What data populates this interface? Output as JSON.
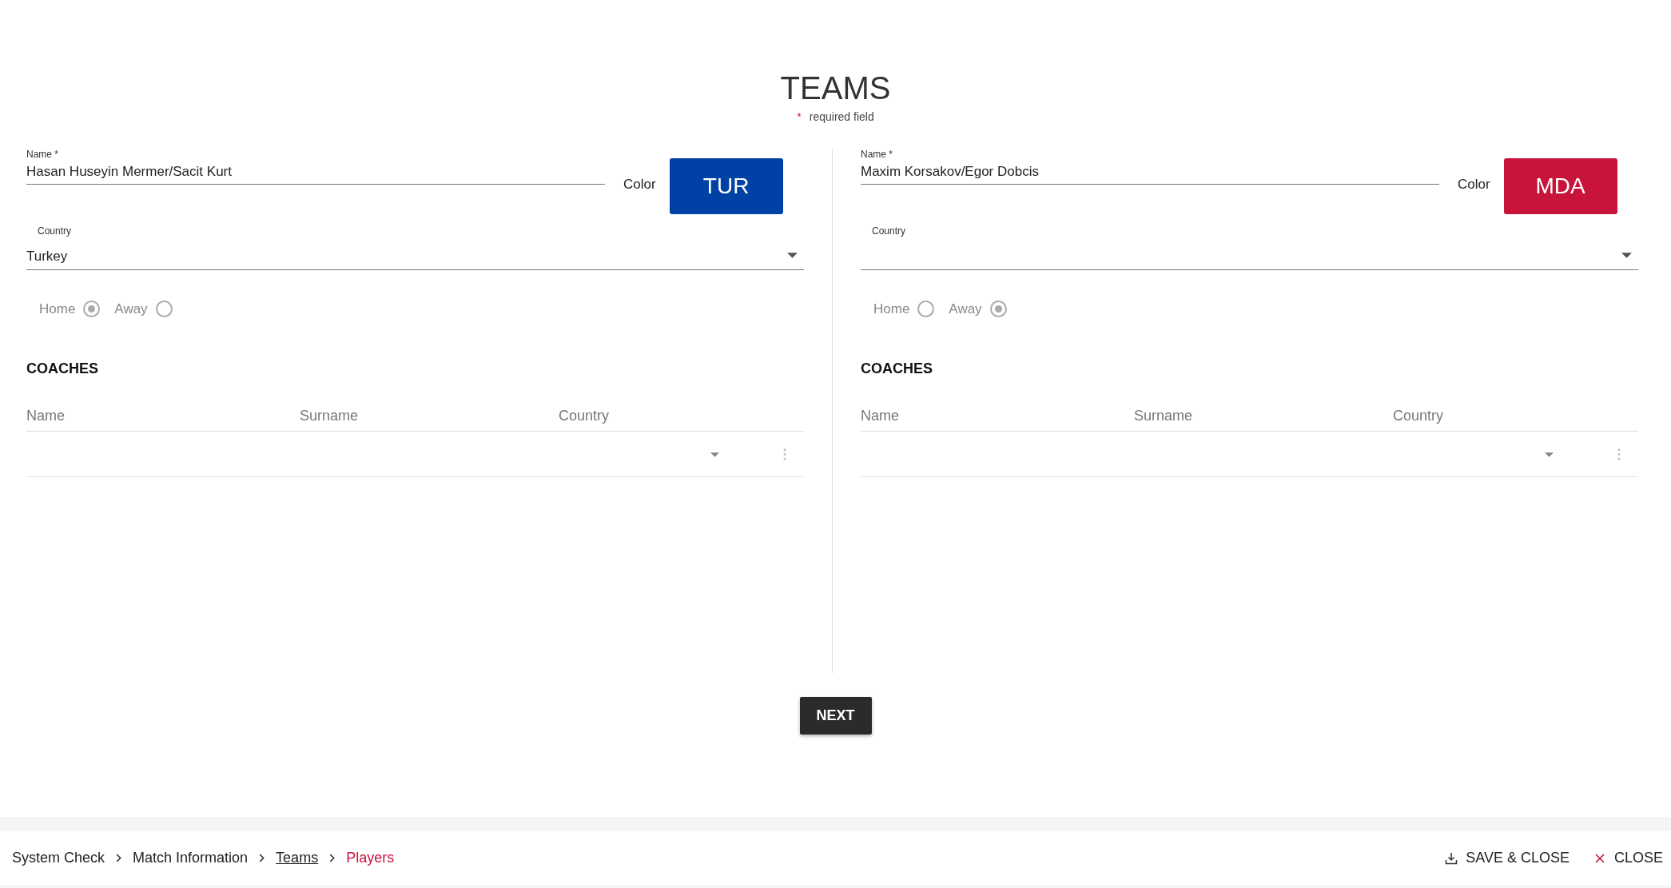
{
  "header": {
    "title": "TEAMS",
    "required_mark": "*",
    "required_note": "required field"
  },
  "teams": [
    {
      "name_label": "Name *",
      "name": "Hasan Huseyin Mermer/Sacit Kurt",
      "color_label": "Color",
      "code": "TUR",
      "color": "#0041a6",
      "country_label": "Country",
      "country": "Turkey",
      "sides": [
        {
          "label": "Home",
          "selected": true
        },
        {
          "label": "Away",
          "selected": false
        }
      ],
      "coaches_title": "COACHES",
      "columns": [
        "Name",
        "Surname",
        "Country"
      ]
    },
    {
      "name_label": "Name *",
      "name": "Maxim Korsakov/Egor Dobcis",
      "color_label": "Color",
      "code": "MDA",
      "color": "#c8133b",
      "country_label": "Country",
      "sides": [
        {
          "label": "Home",
          "selected": false
        },
        {
          "label": "Away",
          "selected": true
        }
      ],
      "coaches_title": "COACHES",
      "columns": [
        "Name",
        "Surname",
        "Country"
      ]
    }
  ],
  "next_button": "NEXT",
  "breadcrumbs": [
    {
      "label": "System Check",
      "kind": "plain"
    },
    {
      "label": "Match Information",
      "kind": "plain"
    },
    {
      "label": "Teams",
      "kind": "link"
    },
    {
      "label": "Players",
      "kind": "current"
    }
  ],
  "actions": [
    {
      "label": "SAVE & CLOSE",
      "kind": "save"
    },
    {
      "label": "CLOSE",
      "kind": "close"
    }
  ]
}
